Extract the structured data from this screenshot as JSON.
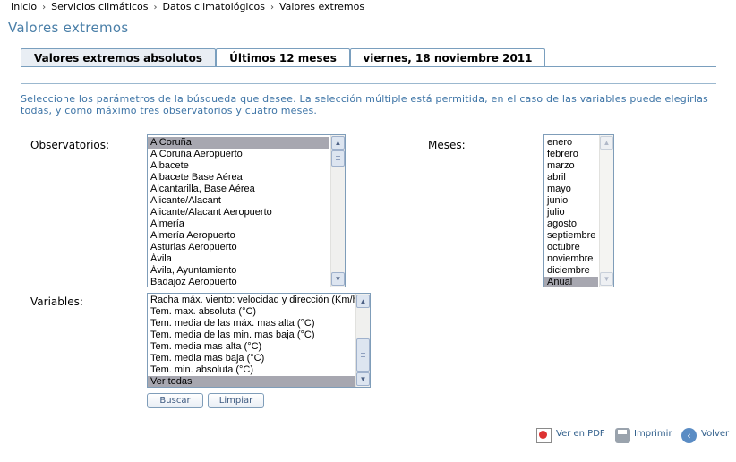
{
  "breadcrumb": [
    "Inicio",
    "Servicios climáticos",
    "Datos climatológicos",
    "Valores extremos"
  ],
  "breadcrumb_sep": "›",
  "page_title": "Valores extremos",
  "tabs": [
    "Valores extremos absolutos",
    "Últimos 12 meses",
    "viernes, 18 noviembre 2011"
  ],
  "instructions": "Seleccione los parámetros de la búsqueda que desee. La selección múltiple está permitida, en el caso de las variables puede elegirlas todas, y como máximo tres observatorios y cuatro meses.",
  "observatorios": {
    "label": "Observatorios:",
    "selected": "A Coruña",
    "options": [
      "A Coruña",
      "A Coruña Aeropuerto",
      "Albacete",
      "Albacete Base Aérea",
      "Alcantarilla, Base Aérea",
      "Alicante/Alacant",
      "Alicante/Alacant Aeropuerto",
      "Almería",
      "Almería Aeropuerto",
      "Asturias Aeropuerto",
      "Ávila",
      "Ávila, Ayuntamiento",
      "Badajoz Aeropuerto"
    ]
  },
  "meses": {
    "label": "Meses:",
    "selected": "Anual",
    "options": [
      "enero",
      "febrero",
      "marzo",
      "abril",
      "mayo",
      "junio",
      "julio",
      "agosto",
      "septiembre",
      "octubre",
      "noviembre",
      "diciembre",
      "Anual"
    ]
  },
  "variables": {
    "label": "Variables:",
    "selected": "Ver todas",
    "options": [
      "Racha máx. viento: velocidad y dirección (Km/h)",
      "Tem. max. absoluta (°C)",
      "Tem. media de las máx. mas alta (°C)",
      "Tem. media de las min. mas baja (°C)",
      "Tem. media mas alta (°C)",
      "Tem. media mas baja (°C)",
      "Tem. min. absoluta (°C)",
      "Ver todas"
    ]
  },
  "buttons": {
    "search": "Buscar",
    "clear": "Limpiar"
  },
  "footer": {
    "pdf": "Ver en PDF",
    "print": "Imprimir",
    "back": "Volver"
  },
  "colors": {
    "accent": "#4a7fa8",
    "instructions": "#3d74a6",
    "selection": "#a7a7b0"
  }
}
